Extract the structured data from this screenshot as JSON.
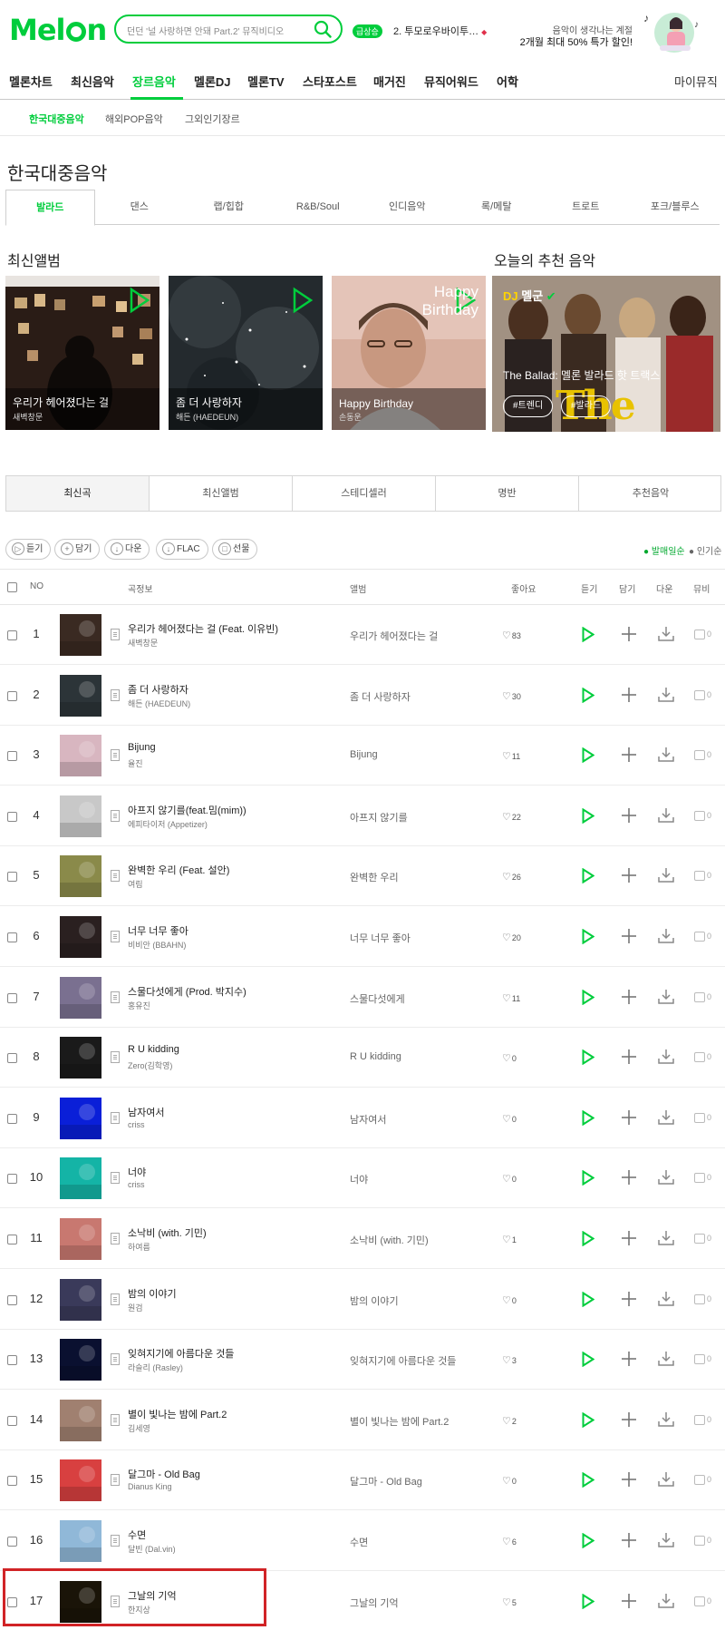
{
  "header": {
    "logo": "Melon",
    "search_placeholder": "던던 '널 사랑하면 안돼 Part.2' 뮤직비디오",
    "rank_badge": "급상승",
    "rank_text": "2. 투모로우바이투…",
    "promo_line1": "음악이 생각나는 계절",
    "promo_line2": "2개월 최대 50% 특가 할인!"
  },
  "gnb": {
    "items": [
      "멜론차트",
      "최신음악",
      "장르음악",
      "멜론DJ",
      "멜론TV",
      "스타포스트",
      "매거진",
      "뮤직어워드",
      "어학"
    ],
    "active_index": 2,
    "right": "마이뮤직"
  },
  "subnav": {
    "items": [
      "한국대중음악",
      "해외POP음악",
      "그외인기장르"
    ],
    "active_index": 0
  },
  "page_title": "한국대중음악",
  "genre_tabs": {
    "items": [
      "발라드",
      "댄스",
      "랩/힙합",
      "R&B/Soul",
      "인디음악",
      "록/메탈",
      "트로트",
      "포크/블루스"
    ],
    "active_index": 0
  },
  "latest_albums": {
    "title": "최신앨범",
    "items": [
      {
        "title": "우리가 헤어졌다는 걸",
        "artist": "새벽창문"
      },
      {
        "title": "좀 더 사랑하자",
        "artist": "해든 (HAEDEUN)"
      },
      {
        "title": "Happy Birthday",
        "artist": "손동운"
      }
    ],
    "album3_art_text": "Happy Birthday"
  },
  "recommend": {
    "title": "오늘의 추천 음악",
    "dj_prefix": "DJ",
    "dj_name": "멜군",
    "headline": "The Ballad: 멜론 발라드 핫 트랙스",
    "tags": [
      "#트렌디",
      "#발라드"
    ],
    "art_text": "The Ballad"
  },
  "list_tabs": {
    "items": [
      "최신곡",
      "최신앨범",
      "스테디셀러",
      "명반",
      "추천음악"
    ],
    "active_index": 0
  },
  "actions": [
    {
      "icon": "▷",
      "label": "듣기"
    },
    {
      "icon": "+",
      "label": "담기"
    },
    {
      "icon": "↓",
      "label": "다운"
    },
    {
      "icon": "↓",
      "label": "FLAC"
    },
    {
      "icon": "□",
      "label": "선물"
    }
  ],
  "sort": {
    "active": "● 발매일순",
    "other": "● 인기순"
  },
  "table_head": {
    "no": "NO",
    "song": "곡정보",
    "album": "앨범",
    "like": "좋아요",
    "listen": "듣기",
    "add": "담기",
    "down": "다운",
    "mv": "뮤비"
  },
  "rows": [
    {
      "no": "1",
      "song": "우리가 헤어졌다는 걸 (Feat. 이유빈)",
      "artist": "새벽창문",
      "album": "우리가 헤어졌다는 걸",
      "likes": "83",
      "mv": "0"
    },
    {
      "no": "2",
      "song": "좀 더 사랑하자",
      "artist": "해든 (HAEDEUN)",
      "album": "좀 더 사랑하자",
      "likes": "30",
      "mv": "0"
    },
    {
      "no": "3",
      "song": "Bijung",
      "artist": "율진",
      "album": "Bijung",
      "likes": "11",
      "mv": "0"
    },
    {
      "no": "4",
      "song": "아프지 않기를(feat.밈(mim))",
      "artist": "에피타이저 (Appetizer)",
      "album": "아프지 않기를",
      "likes": "22",
      "mv": "0"
    },
    {
      "no": "5",
      "song": "완벽한 우리 (Feat. 설안)",
      "artist": "여림",
      "album": "완벽한 우리",
      "likes": "26",
      "mv": "0"
    },
    {
      "no": "6",
      "song": "너무 너무 좋아",
      "artist": "비비안 (BBAHN)",
      "album": "너무 너무 좋아",
      "likes": "20",
      "mv": "0"
    },
    {
      "no": "7",
      "song": "스물다섯에게 (Prod. 박지수)",
      "artist": "홍유진",
      "album": "스물다섯에게",
      "likes": "11",
      "mv": "0"
    },
    {
      "no": "8",
      "song": "R U kidding",
      "artist": "Zero(김학영)",
      "album": "R U kidding",
      "likes": "0",
      "mv": "0"
    },
    {
      "no": "9",
      "song": "남자여서",
      "artist": "criss",
      "album": "남자여서",
      "likes": "0",
      "mv": "0"
    },
    {
      "no": "10",
      "song": "너야",
      "artist": "criss",
      "album": "너야",
      "likes": "0",
      "mv": "0"
    },
    {
      "no": "11",
      "song": "소낙비 (with. 기민)",
      "artist": "하여름",
      "album": "소낙비 (with. 기민)",
      "likes": "1",
      "mv": "0"
    },
    {
      "no": "12",
      "song": "밤의 이야기",
      "artist": "원검",
      "album": "밤의 이야기",
      "likes": "0",
      "mv": "0"
    },
    {
      "no": "13",
      "song": "잊혀지기에 아름다운 것들",
      "artist": "라슬리 (Rasley)",
      "album": "잊혀지기에 아름다운 것들",
      "likes": "3",
      "mv": "0"
    },
    {
      "no": "14",
      "song": "별이 빛나는 밤에 Part.2",
      "artist": "김세영",
      "album": "별이 빛나는 밤에 Part.2",
      "likes": "2",
      "mv": "0"
    },
    {
      "no": "15",
      "song": "달그마 - Old Bag",
      "artist": "Dianus King",
      "album": "달그마 - Old Bag",
      "likes": "0",
      "mv": "0"
    },
    {
      "no": "16",
      "song": "수면",
      "artist": "달빈 (Dal.vin)",
      "album": "수면",
      "likes": "6",
      "mv": "0"
    },
    {
      "no": "17",
      "song": "그날의 기억",
      "artist": "한지상",
      "album": "그날의 기억",
      "likes": "5",
      "mv": "0"
    }
  ],
  "thumb_colors": [
    "#3a2a22",
    "#2c3438",
    "#d8b6c0",
    "#c8c8c8",
    "#8a8a4a",
    "#2a2020",
    "#7a7090",
    "#1a1a1a",
    "#0a1fd8",
    "#14b4a6",
    "#c87870",
    "#3a3a5a",
    "#0a1030",
    "#a08070",
    "#d84040",
    "#90b8d8",
    "#1a1408"
  ],
  "colors": {
    "accent": "#00cd3c",
    "highlight": "#d12326"
  }
}
